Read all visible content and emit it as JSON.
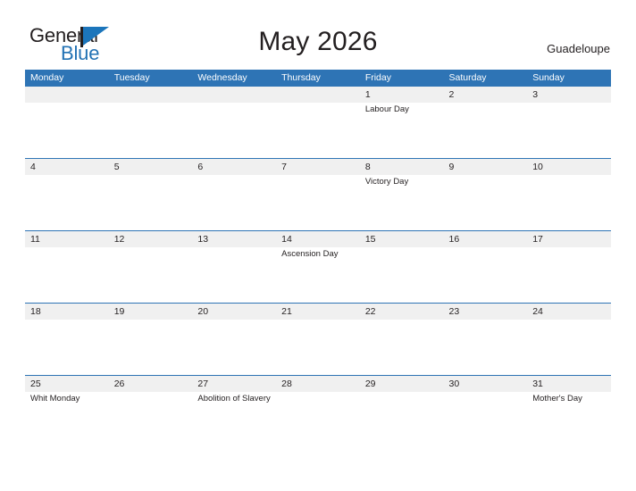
{
  "brand": {
    "name_part1": "General",
    "name_part2": "Blue",
    "flag_icon": "flag-triangle-icon",
    "accent_color": "#1b75bb"
  },
  "header": {
    "title": "May 2026",
    "region": "Guadeloupe"
  },
  "theme": {
    "header_row_color": "#2e74b5",
    "band_color": "#f0f0f0",
    "rule_color": "#2e74b5",
    "text_color": "#231f20",
    "background": "#ffffff"
  },
  "calendar": {
    "month": "May",
    "year": "2026",
    "weekdays": [
      "Monday",
      "Tuesday",
      "Wednesday",
      "Thursday",
      "Friday",
      "Saturday",
      "Sunday"
    ],
    "weeks": [
      [
        {
          "day": "",
          "event": ""
        },
        {
          "day": "",
          "event": ""
        },
        {
          "day": "",
          "event": ""
        },
        {
          "day": "",
          "event": ""
        },
        {
          "day": "1",
          "event": "Labour Day"
        },
        {
          "day": "2",
          "event": ""
        },
        {
          "day": "3",
          "event": ""
        }
      ],
      [
        {
          "day": "4",
          "event": ""
        },
        {
          "day": "5",
          "event": ""
        },
        {
          "day": "6",
          "event": ""
        },
        {
          "day": "7",
          "event": ""
        },
        {
          "day": "8",
          "event": "Victory Day"
        },
        {
          "day": "9",
          "event": ""
        },
        {
          "day": "10",
          "event": ""
        }
      ],
      [
        {
          "day": "11",
          "event": ""
        },
        {
          "day": "12",
          "event": ""
        },
        {
          "day": "13",
          "event": ""
        },
        {
          "day": "14",
          "event": "Ascension Day"
        },
        {
          "day": "15",
          "event": ""
        },
        {
          "day": "16",
          "event": ""
        },
        {
          "day": "17",
          "event": ""
        }
      ],
      [
        {
          "day": "18",
          "event": ""
        },
        {
          "day": "19",
          "event": ""
        },
        {
          "day": "20",
          "event": ""
        },
        {
          "day": "21",
          "event": ""
        },
        {
          "day": "22",
          "event": ""
        },
        {
          "day": "23",
          "event": ""
        },
        {
          "day": "24",
          "event": ""
        }
      ],
      [
        {
          "day": "25",
          "event": "Whit Monday"
        },
        {
          "day": "26",
          "event": ""
        },
        {
          "day": "27",
          "event": "Abolition of Slavery"
        },
        {
          "day": "28",
          "event": ""
        },
        {
          "day": "29",
          "event": ""
        },
        {
          "day": "30",
          "event": ""
        },
        {
          "day": "31",
          "event": "Mother's Day"
        }
      ]
    ]
  }
}
